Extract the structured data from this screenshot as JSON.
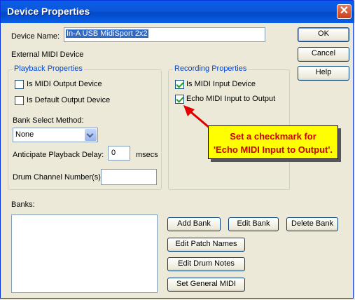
{
  "window": {
    "title": "Device Properties",
    "close_glyph": "✕"
  },
  "device": {
    "name_label": "Device Name:",
    "name_value": "In-A USB MidiSport 2x2",
    "type_label": "External MIDI Device"
  },
  "buttons": {
    "ok": "OK",
    "cancel": "Cancel",
    "help": "Help"
  },
  "playback": {
    "legend": "Playback Properties",
    "is_midi_output": {
      "label": "Is MIDI Output Device",
      "checked": false
    },
    "is_default_output": {
      "label": "Is Default Output Device",
      "checked": false
    },
    "bank_select_label": "Bank Select Method:",
    "bank_select_value": "None",
    "anticipate_label": "Anticipate Playback Delay:",
    "anticipate_value": "0",
    "anticipate_unit": "msecs",
    "drum_channel_label": "Drum Channel Number(s):",
    "drum_channel_value": ""
  },
  "recording": {
    "legend": "Recording Properties",
    "is_midi_input": {
      "label": "Is MIDI Input Device",
      "checked": true
    },
    "echo_midi": {
      "label": "Echo MIDI Input to Output",
      "checked": true
    }
  },
  "callout": {
    "line1": "Set a checkmark for",
    "line2": "'Echo MIDI Input to Output'.",
    "arrow_color": "#e00000"
  },
  "banks": {
    "label": "Banks:",
    "add": "Add Bank",
    "edit": "Edit Bank",
    "delete": "Delete Bank",
    "edit_patch": "Edit Patch Names",
    "edit_drum": "Edit Drum Notes",
    "set_gm": "Set General MIDI"
  }
}
